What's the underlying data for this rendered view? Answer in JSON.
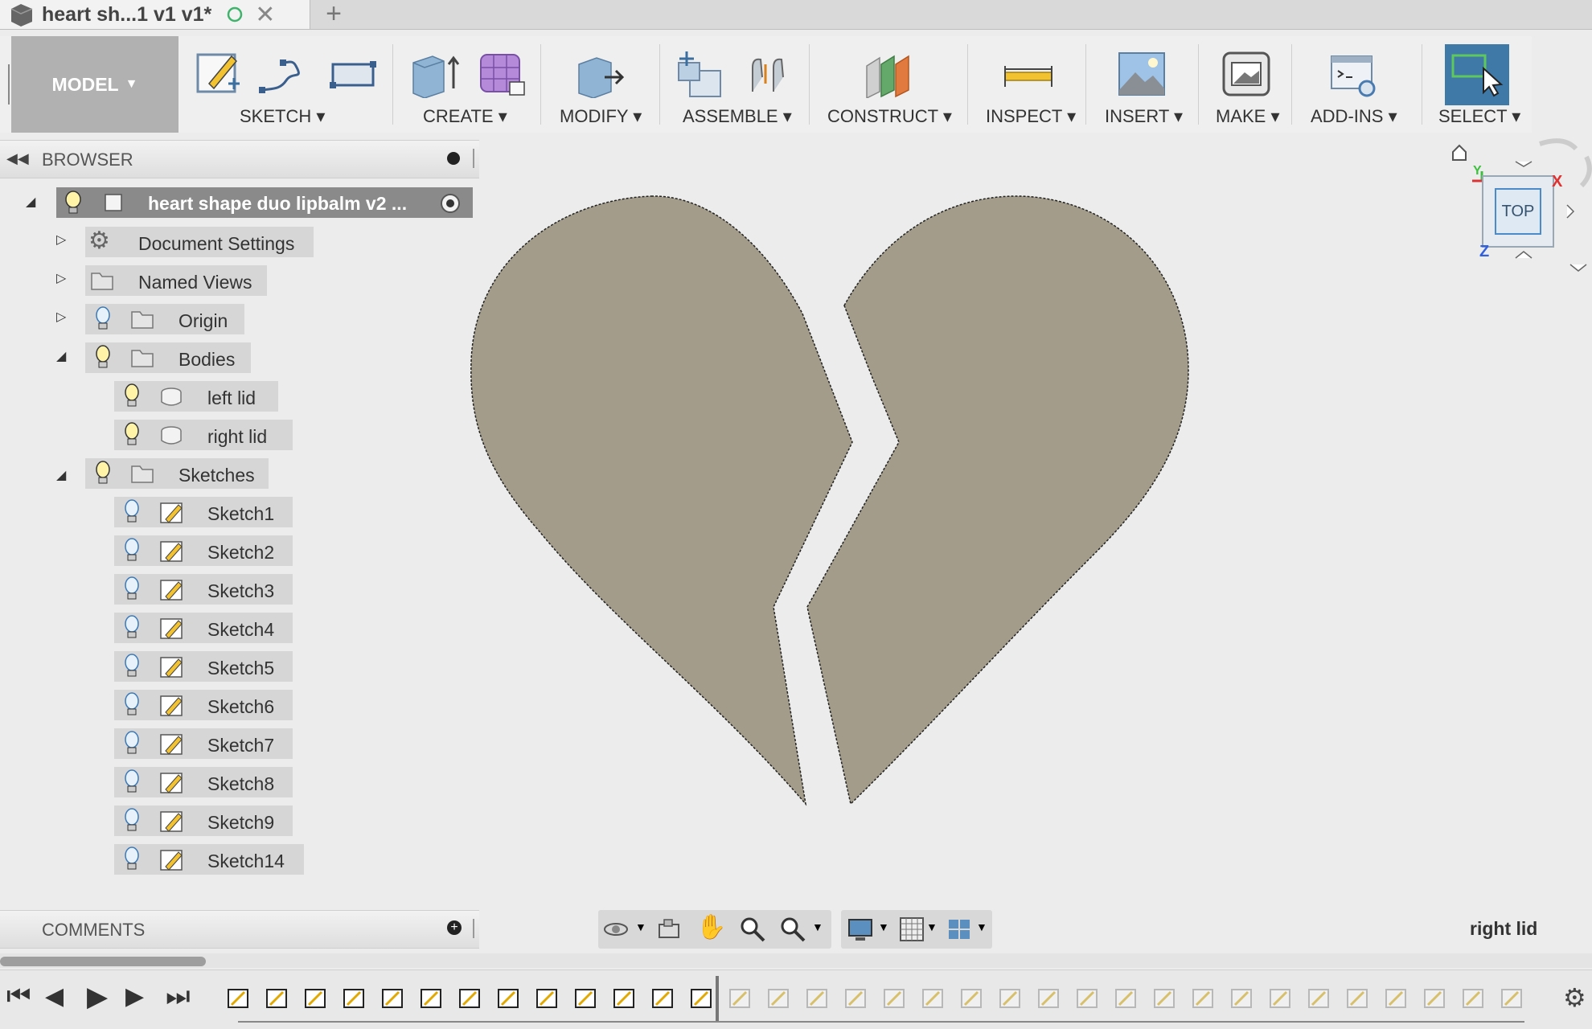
{
  "tab": {
    "title": "heart sh...1 v1 v1*"
  },
  "toolbar": {
    "model": "MODEL",
    "groups": [
      "SKETCH",
      "CREATE",
      "MODIFY",
      "ASSEMBLE",
      "CONSTRUCT",
      "INSPECT",
      "INSERT",
      "MAKE",
      "ADD-INS",
      "SELECT"
    ]
  },
  "browser": {
    "title": "BROWSER",
    "root": "heart shape duo lipbalm v2 ...",
    "items": {
      "document_settings": "Document Settings",
      "named_views": "Named Views",
      "origin": "Origin",
      "bodies": "Bodies",
      "left_lid": "left lid",
      "right_lid": "right lid",
      "sketches": "Sketches"
    },
    "sketches": [
      "Sketch1",
      "Sketch2",
      "Sketch3",
      "Sketch4",
      "Sketch5",
      "Sketch6",
      "Sketch7",
      "Sketch8",
      "Sketch9",
      "Sketch14"
    ]
  },
  "comments": {
    "title": "COMMENTS"
  },
  "viewcube": {
    "face": "TOP",
    "axis_x": "X",
    "axis_y": "Y",
    "axis_z": "Z"
  },
  "status": {
    "selection": "right lid"
  },
  "colors": {
    "body": "#a39c8a",
    "accent": "#3f79a8",
    "canvas": "#ececec"
  }
}
